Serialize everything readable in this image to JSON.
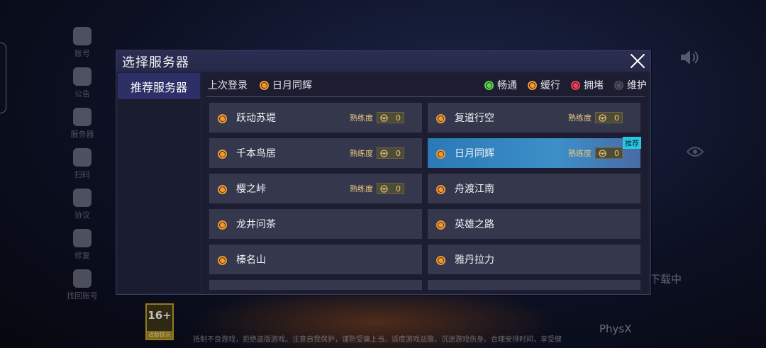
{
  "background": {
    "left_menu": [
      {
        "label": "账号",
        "icon": "account-icon"
      },
      {
        "label": "公告",
        "icon": "announcement-icon"
      },
      {
        "label": "服务器",
        "icon": "server-icon"
      },
      {
        "label": "扫码",
        "icon": "scan-icon"
      },
      {
        "label": "协议",
        "icon": "agreement-icon"
      },
      {
        "label": "修复",
        "icon": "repair-icon"
      },
      {
        "label": "找回账号",
        "icon": "recover-account-icon"
      }
    ],
    "download_text": "下载中",
    "age_rating": {
      "number": "16+",
      "label": "适龄提示"
    },
    "physx": "PhysX",
    "legal_text": "抵制不良游戏，拒绝盗版游戏。注意自我保护，谨防受骗上当。适度游戏益脑，沉迷游戏伤身。合理安排时间，享受健康生活。"
  },
  "dialog": {
    "title": "选择服务器",
    "close_icon": "close-icon",
    "sidebar_tab": "推荐服务器",
    "last_login_label": "上次登录",
    "last_login_server": "日月同辉",
    "legend": [
      {
        "label": "畅通",
        "color": "#5fd24a"
      },
      {
        "label": "缓行",
        "color": "#f39a2e"
      },
      {
        "label": "拥堵",
        "color": "#ef4057"
      },
      {
        "label": "维护",
        "color": "#4b4d5c"
      }
    ],
    "proficiency_label": "熟练度",
    "recommend_badge": "推荐",
    "servers": [
      {
        "name": "跃动苏堤",
        "status": "缓行",
        "proficiency": "0"
      },
      {
        "name": "复道行空",
        "status": "缓行",
        "proficiency": "0"
      },
      {
        "name": "千本鸟居",
        "status": "缓行",
        "proficiency": "0"
      },
      {
        "name": "日月同辉",
        "status": "缓行",
        "proficiency": "0",
        "selected": true,
        "recommended": true
      },
      {
        "name": "樱之峠",
        "status": "缓行",
        "proficiency": "0"
      },
      {
        "name": "舟渡江南",
        "status": "缓行"
      },
      {
        "name": "龙井问茶",
        "status": "缓行"
      },
      {
        "name": "英雄之路",
        "status": "缓行"
      },
      {
        "name": "榛名山",
        "status": "缓行"
      },
      {
        "name": "雅丹拉力",
        "status": "缓行"
      }
    ]
  }
}
